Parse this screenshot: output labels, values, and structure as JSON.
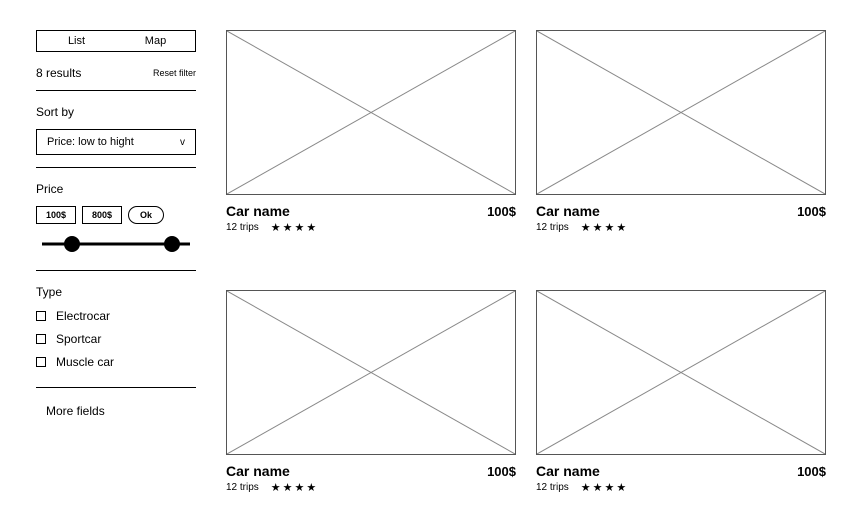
{
  "sidebar": {
    "view": {
      "list": "List",
      "map": "Map"
    },
    "results_count": "8 results",
    "reset_label": "Reset filter",
    "sort": {
      "label": "Sort by",
      "selected": "Price: low to hight"
    },
    "price": {
      "label": "Price",
      "min": "100$",
      "max": "800$",
      "ok_label": "Ok"
    },
    "type": {
      "label": "Type",
      "options": [
        "Electrocar",
        "Sportcar",
        "Muscle car"
      ]
    },
    "more_label": "More fields"
  },
  "cards": [
    {
      "name": "Car name",
      "price": "100$",
      "trips": "12 trips",
      "stars": "★★★★"
    },
    {
      "name": "Car name",
      "price": "100$",
      "trips": "12 trips",
      "stars": "★★★★"
    },
    {
      "name": "Car name",
      "price": "100$",
      "trips": "12 trips",
      "stars": "★★★★"
    },
    {
      "name": "Car name",
      "price": "100$",
      "trips": "12 trips",
      "stars": "★★★★"
    }
  ]
}
